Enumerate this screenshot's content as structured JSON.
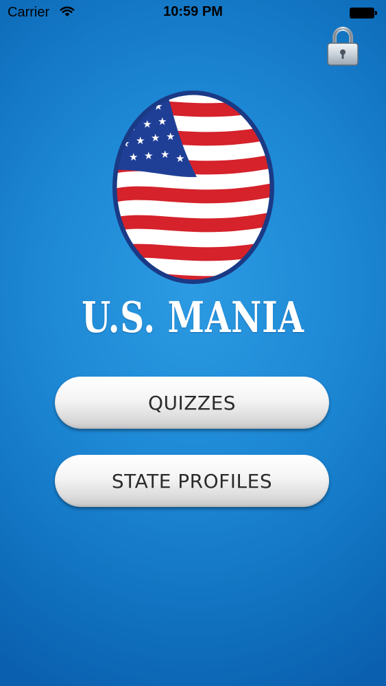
{
  "status_bar": {
    "carrier": "Carrier",
    "time": "10:59 PM"
  },
  "app": {
    "title": "U.S. MANIA"
  },
  "menu": {
    "quizzes_label": "QUIZZES",
    "state_profiles_label": "STATE PROFILES"
  },
  "icons": {
    "lock": "padlock-icon",
    "logo": "american-flag-logo"
  },
  "colors": {
    "background": "#1c86d3",
    "flag_red": "#d5222b",
    "flag_blue": "#1f3f97",
    "button_text": "#2b2b2b"
  }
}
